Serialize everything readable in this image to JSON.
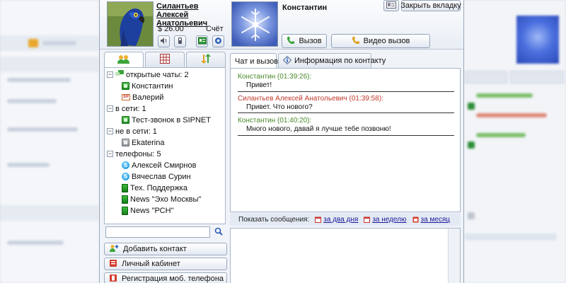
{
  "header": {
    "user_name": "Силантьев Алексей Анатольевич",
    "balance": "$ 26.00",
    "account_link": "Счёт",
    "contact_name": "Константин",
    "close_tab_label": "Закрыть вкладку",
    "call_label": "Вызов",
    "video_call_label": "Видео вызов"
  },
  "contacts": {
    "groups": [
      {
        "label": "открытые чаты: 2",
        "items": [
          {
            "name": "Константин",
            "icon": "green-contact-icon"
          },
          {
            "name": "Валерий",
            "icon": "sip-contact-icon"
          }
        ]
      },
      {
        "label": "в сети: 1",
        "items": [
          {
            "name": "Тест-звонок в SIPNET",
            "icon": "green-contact-icon"
          }
        ]
      },
      {
        "label": "не в сети: 1",
        "items": [
          {
            "name": "Ekaterina",
            "icon": "gray-contact-icon"
          }
        ]
      },
      {
        "label": "телефоны: 5",
        "items": [
          {
            "name": "Алексей Смирнов",
            "icon": "skype-icon"
          },
          {
            "name": "Вячеслав Сурин",
            "icon": "skype-icon"
          },
          {
            "name": "Тех. Поддержка",
            "icon": "phone-icon"
          },
          {
            "name": "News \"Эхо Москвы\"",
            "icon": "phone-icon"
          },
          {
            "name": "News \"РСН\"",
            "icon": "phone-icon"
          }
        ]
      }
    ],
    "search_placeholder": ""
  },
  "actions": {
    "add_contact": "Добавить контакт",
    "personal_cabinet": "Личный кабинет",
    "register_mobile": "Регистрация моб. телефона"
  },
  "chat": {
    "tabs": [
      "Чат и вызовы",
      "Информация по контакту"
    ],
    "messages": [
      {
        "author": "Константин (01:39:26):",
        "text": "Привет!",
        "color": "#4a8a2a"
      },
      {
        "author": "Силантьев Алексей Анатольевич (01:39:58):",
        "text": "Привет. Что нового?",
        "color": "#c0392b"
      },
      {
        "author": "Константин (01:40:20):",
        "text": "Много нового, давай я лучше тебе позвоню!",
        "color": "#4a8a2a"
      }
    ],
    "filter_label": "Показать сообщения:",
    "filter_links": [
      "за два дня",
      "за неделю",
      "за месяц"
    ]
  }
}
